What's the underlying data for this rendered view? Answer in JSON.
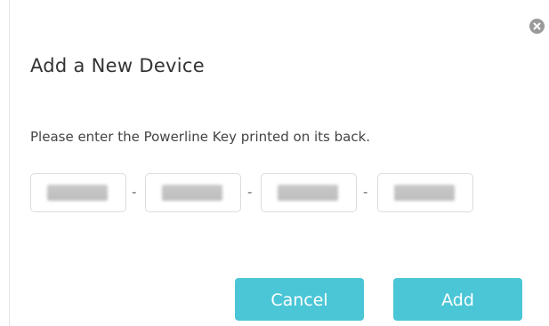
{
  "dialog": {
    "title": "Add a New Device",
    "instruction": "Please enter the Powerline Key printed on its back.",
    "key_fields": [
      {
        "value": "",
        "redacted": true
      },
      {
        "value": "",
        "redacted": true
      },
      {
        "value": "",
        "redacted": true
      },
      {
        "value": "",
        "redacted": true
      }
    ],
    "separator": "-",
    "buttons": {
      "cancel": "Cancel",
      "add": "Add"
    },
    "close_icon": "close-circle-icon"
  },
  "colors": {
    "accent": "#4ac6d6",
    "close_icon": "#9a9a9a",
    "border": "#dcdcdc",
    "text": "#333333"
  }
}
